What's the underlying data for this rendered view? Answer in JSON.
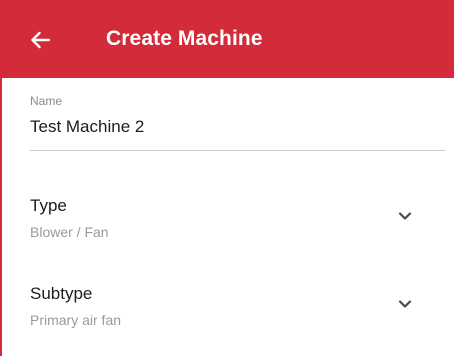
{
  "header": {
    "title": "Create Machine",
    "back_icon": "arrow-left-icon",
    "background_color": "#d32b3a"
  },
  "form": {
    "name": {
      "label": "Name",
      "value": "Test Machine 2"
    },
    "type": {
      "label": "Type",
      "value": "Blower / Fan",
      "icon": "chevron-down-icon"
    },
    "subtype": {
      "label": "Subtype",
      "value": "Primary air fan",
      "icon": "chevron-down-icon"
    }
  }
}
